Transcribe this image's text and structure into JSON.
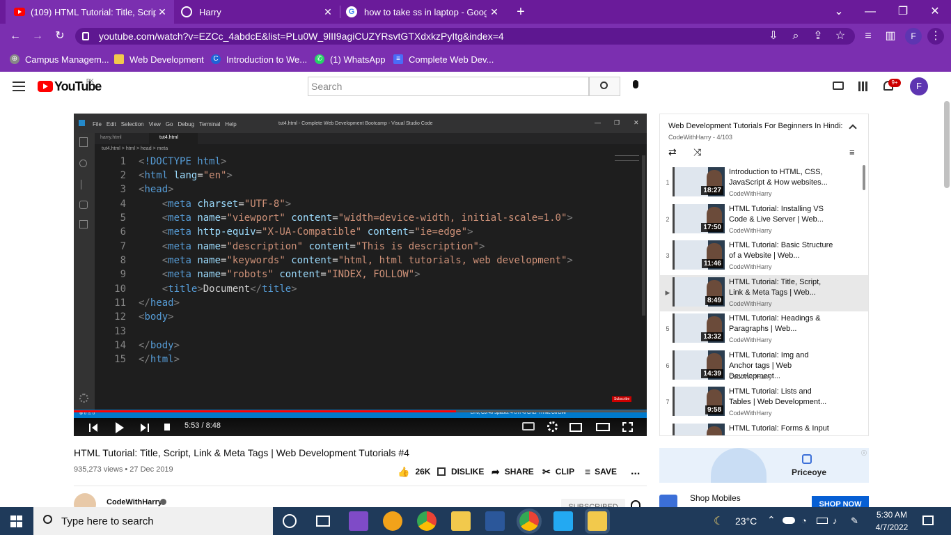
{
  "browser": {
    "tabs": [
      {
        "title": "(109) HTML Tutorial: Title, Script,",
        "icon": "youtube-icon",
        "active": true
      },
      {
        "title": "Harry",
        "icon": "globe-icon",
        "active": false
      },
      {
        "title": "how to take ss in laptop - Google",
        "icon": "google-icon",
        "active": false
      }
    ],
    "new_tab": "+",
    "url": "youtube.com/watch?v=EZCc_4abdcE&list=PLu0W_9lII9agiCUZYRsvtGTXdxkzPyItg&index=4",
    "profile_initial": "F",
    "bookmarks": [
      {
        "label": "Campus Managem...",
        "icon": "campus-icon"
      },
      {
        "label": "Web Development",
        "icon": "folder-icon"
      },
      {
        "label": "Introduction to We...",
        "icon": "c-icon"
      },
      {
        "label": "(1) WhatsApp",
        "icon": "whatsapp-icon"
      },
      {
        "label": "Complete Web Dev...",
        "icon": "doc-icon"
      }
    ]
  },
  "youtube": {
    "logo_text": "YouTube",
    "region": "PK",
    "search_placeholder": "Search",
    "notification_count": "9+",
    "avatar_initial": "F"
  },
  "vscode": {
    "menu": [
      "File",
      "Edit",
      "Selection",
      "View",
      "Go",
      "Debug",
      "Terminal",
      "Help"
    ],
    "window_title": "tut4.html - Complete Web Development Bootcamp - Visual Studio Code",
    "tabs": [
      "harry.html",
      "tut4.html"
    ],
    "breadcrumb": "tut4.html > html > head > meta",
    "line_numbers": [
      "1",
      "2",
      "3",
      "4",
      "5",
      "6",
      "7",
      "8",
      "9",
      "10",
      "11",
      "12",
      "13",
      "14",
      "15"
    ],
    "status_left": "⊗ 0 ⚠ 0",
    "status_right": "Ln 8, Col 49   Spaces: 4   UTF-8   CRLF   HTML   Go Live",
    "subscribe_badge": "Subscribe"
  },
  "player": {
    "time": "5:53 / 8:48",
    "progress_fraction": 0.667
  },
  "video": {
    "title": "HTML Tutorial: Title, Script, Link & Meta Tags | Web Development Tutorials #4",
    "views_date": "935,273 views • 27 Dec 2019",
    "likes": "26K",
    "dislike": "DISLIKE",
    "share": "SHARE",
    "clip": "CLIP",
    "save": "SAVE",
    "more": "...",
    "channel": "CodeWithHarry",
    "subscribed": "SUBSCRIBED"
  },
  "playlist": {
    "title": "Web Development Tutorials For Beginners In Hindi:...",
    "subtitle": "CodeWithHarry - 4/103",
    "items": [
      {
        "index": "1",
        "title": "Introduction to HTML, CSS, JavaScript & How websites...",
        "channel": "CodeWithHarry",
        "duration": "18:27",
        "current": false
      },
      {
        "index": "2",
        "title": "HTML Tutorial: Installing VS Code & Live Server | Web...",
        "channel": "CodeWithHarry",
        "duration": "17:50",
        "current": false
      },
      {
        "index": "3",
        "title": "HTML Tutorial: Basic Structure of a Website | Web...",
        "channel": "CodeWithHarry",
        "duration": "11:46",
        "current": false
      },
      {
        "index": "▶",
        "title": "HTML Tutorial: Title, Script, Link & Meta Tags | Web...",
        "channel": "CodeWithHarry",
        "duration": "8:49",
        "current": true
      },
      {
        "index": "5",
        "title": "HTML Tutorial: Headings & Paragraphs | Web...",
        "channel": "CodeWithHarry",
        "duration": "13:32",
        "current": false
      },
      {
        "index": "6",
        "title": "HTML Tutorial: Img and Anchor tags | Web Development...",
        "channel": "CodeWithHarry",
        "duration": "14:39",
        "current": false
      },
      {
        "index": "7",
        "title": "HTML Tutorial: Lists and Tables | Web Development...",
        "channel": "CodeWithHarry",
        "duration": "9:58",
        "current": false
      },
      {
        "index": "",
        "title": "HTML Tutorial: Forms & Input",
        "channel": "",
        "duration": "",
        "current": false
      }
    ]
  },
  "ads": {
    "brand": "Priceoye",
    "shop_text": "Shop Mobiles",
    "shop_button": "SHOP NOW"
  },
  "taskbar": {
    "search_placeholder": "Type here to search",
    "temperature": "23°C",
    "time": "5:30 AM",
    "date": "4/7/2022"
  }
}
